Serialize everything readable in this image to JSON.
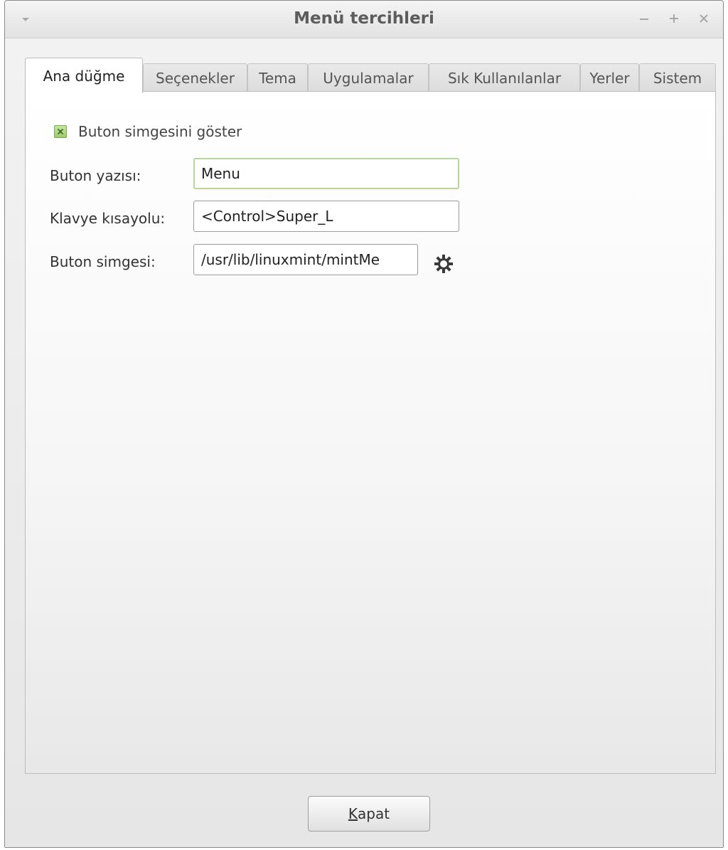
{
  "window": {
    "title": "Menü tercihleri"
  },
  "tabs": [
    {
      "label": "Ana düğme",
      "active": true
    },
    {
      "label": "Seçenekler",
      "active": false
    },
    {
      "label": "Tema",
      "active": false
    },
    {
      "label": "Uygulamalar",
      "active": false
    },
    {
      "label": "Sık Kullanılanlar",
      "active": false
    },
    {
      "label": "Yerler",
      "active": false
    },
    {
      "label": "Sistem",
      "active": false
    }
  ],
  "form": {
    "show_icon_label": "Buton simgesini göster",
    "show_icon_checked": true,
    "button_text_label": "Buton yazısı:",
    "button_text_value": "Menu",
    "shortcut_label": "Klavye kısayolu:",
    "shortcut_value": "<Control>Super_L",
    "icon_label": "Buton simgesi:",
    "icon_value": "/usr/lib/linuxmint/mintMe"
  },
  "footer": {
    "close_mnemonic": "K",
    "close_rest": "apat"
  },
  "colors": {
    "check_green": "#9ccb6d",
    "focus_green": "#b7d49a"
  }
}
